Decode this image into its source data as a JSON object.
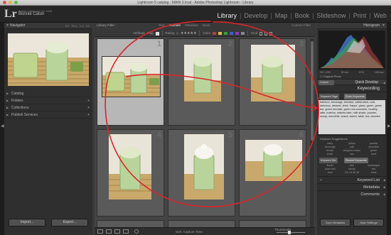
{
  "window": {
    "title": "Lightroom 5 catalog - MAIN 3.lrcat - Adobe Photoshop Lightroom - Library"
  },
  "identity": {
    "logo": "Lr",
    "line1": "Adobe Lightroom CC 2015",
    "user": "Bonnie Caton"
  },
  "modules": {
    "items": [
      "Library",
      "Develop",
      "Map",
      "Book",
      "Slideshow",
      "Print",
      "Web"
    ],
    "active": "Library",
    "separator": "|"
  },
  "left_panel": {
    "navigator": {
      "title": "Navigator",
      "options": [
        "FIT",
        "FILL",
        "1:1",
        "3:1"
      ]
    },
    "sections": [
      {
        "label": "Catalog",
        "has_plus": false
      },
      {
        "label": "Folders",
        "has_plus": true
      },
      {
        "label": "Collections",
        "has_plus": true
      },
      {
        "label": "Publish Services",
        "has_plus": true
      }
    ],
    "buttons": {
      "import": "Import...",
      "export": "Export..."
    }
  },
  "filter_bar": {
    "title": "Library Filter :",
    "tabs": [
      "Text",
      "Attribute",
      "Metadata",
      "None"
    ],
    "active_tab": "Attribute",
    "custom": "Custom Filter",
    "attribute_label": "Attribute",
    "flag_label": "Flag",
    "rating_label": "Rating",
    "rating_op": "≥",
    "stars": "★★★★★",
    "color_label": "Color",
    "kind_label": "Kind",
    "colors": [
      "#c23b3b",
      "#d9c23a",
      "#3f9a3f",
      "#3a62c2",
      "#8a3ac2",
      "#888888"
    ]
  },
  "grid": {
    "cells": [
      {
        "num": "1",
        "selected": true
      },
      {
        "num": "2",
        "selected": false
      },
      {
        "num": "3",
        "selected": false
      },
      {
        "num": "4",
        "selected": false
      },
      {
        "num": "5",
        "selected": false
      },
      {
        "num": "6",
        "selected": false
      }
    ]
  },
  "toolbar": {
    "sort_label": "Sort:",
    "sort_value": "Capture Time",
    "thumbnails_label": "Thumbnails"
  },
  "histogram": {
    "title": "Histogram",
    "meta": [
      "ISO 1250",
      "35 mm",
      "f/2.8",
      "1/60 sec"
    ],
    "original_photo": "Original Photo"
  },
  "quick_develop": {
    "preset": "Custom",
    "title": "Quick Develop"
  },
  "keywording": {
    "title": "Keywording",
    "tags_label": "Keyword Tags",
    "tags_mode": "Enter Keywords",
    "keywords_text": "bamboo, beverage, blended, caffeinated, cold, delicious, dessert, drink, frappe, glass, green, green tea, green tea latte, green tea smoothie, healthy, latte, matcha, matcha latte, milk shake, powder, scoop, smoothie, snack, sweet, table, tea, wooden",
    "suggestions_label": "Keyword Suggestions",
    "suggestions": [
      "dairy",
      "yellow",
      "powder",
      "beverage",
      "cold",
      "smoothie",
      "brown",
      "whipped cream",
      "green",
      "fresh",
      "tea",
      "bowl"
    ],
    "set_label": "Keyword Set",
    "set_value": "Recent Keywords",
    "set_items": [
      "flower",
      "tree",
      "hydrangea",
      "plant drill",
      "family",
      "tea",
      "blue",
      "CH 13 00 06",
      "drink"
    ]
  },
  "right_sections": [
    "Keyword List",
    "Metadata",
    "Comments"
  ],
  "right_buttons": {
    "sync_metadata": "Sync Metadata",
    "sync_settings": "Sync Settings"
  }
}
